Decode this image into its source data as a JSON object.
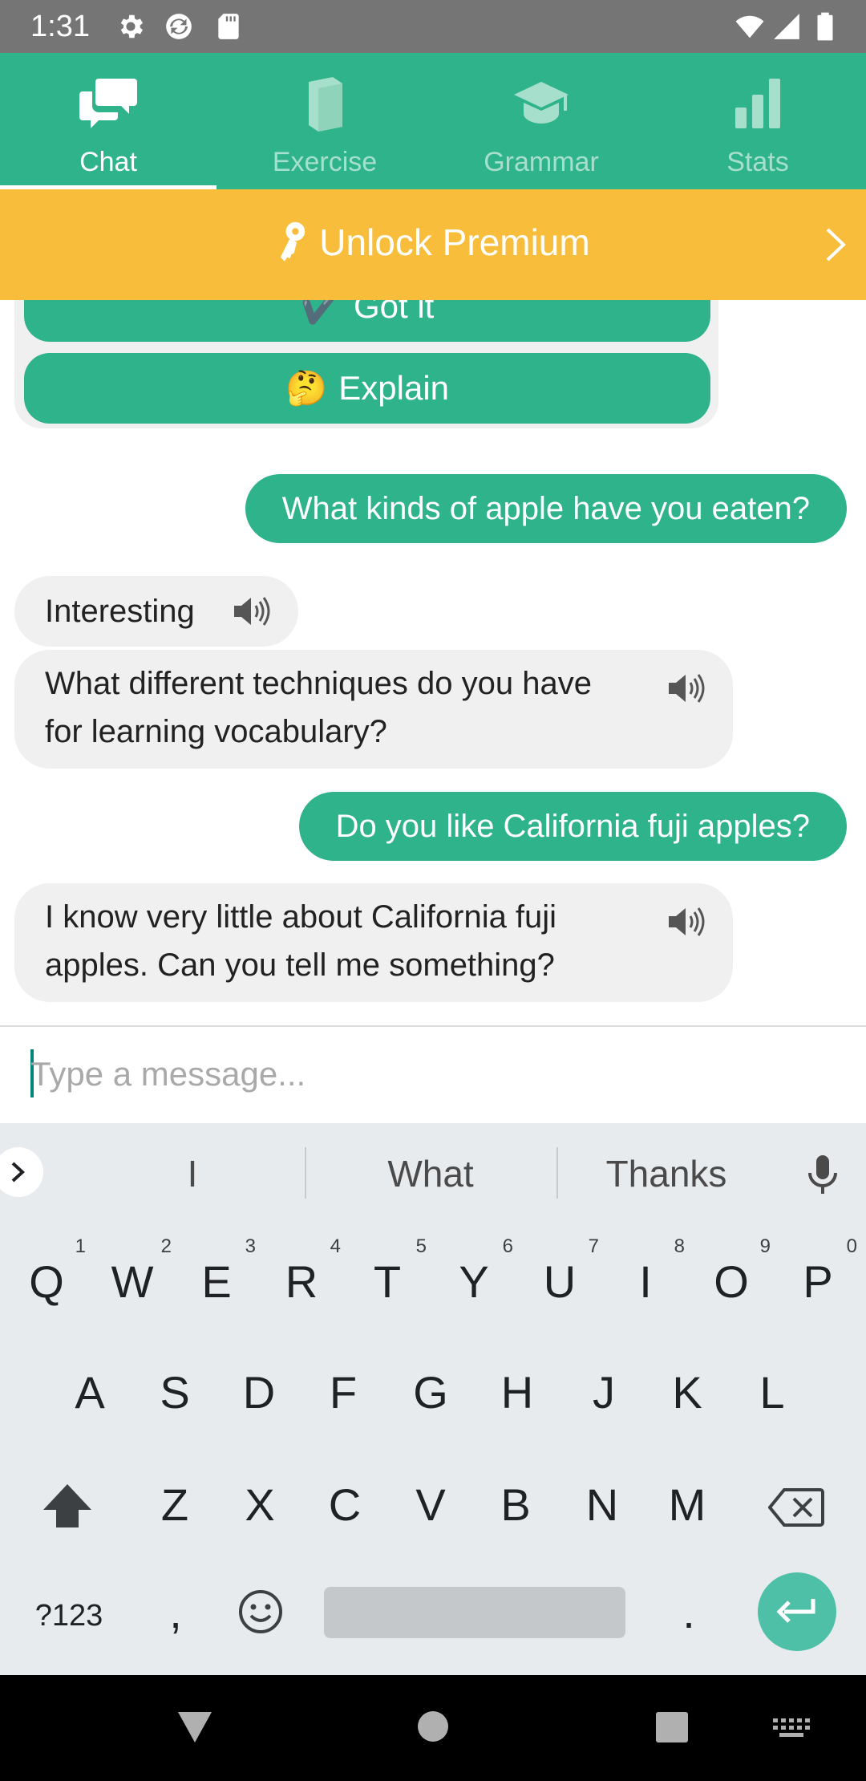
{
  "status_bar": {
    "time": "1:31",
    "left_icons": [
      "settings-icon",
      "sync-icon",
      "sd-card-icon"
    ],
    "right_icons": [
      "wifi-icon",
      "signal-icon",
      "battery-icon"
    ]
  },
  "tabs": [
    {
      "label": "Chat",
      "icon": "chat-icon",
      "active": true
    },
    {
      "label": "Exercise",
      "icon": "book-icon",
      "active": false
    },
    {
      "label": "Grammar",
      "icon": "graduation-cap-icon",
      "active": false
    },
    {
      "label": "Stats",
      "icon": "bar-chart-icon",
      "active": false
    }
  ],
  "premium": {
    "label": "Unlock Premium",
    "icon": "key-icon"
  },
  "actions": {
    "got_it": {
      "emoji": "✔️",
      "label": "Got it"
    },
    "explain": {
      "emoji": "🤔",
      "label": "Explain"
    }
  },
  "messages": [
    {
      "from": "user",
      "text": "What kinds of apple have you eaten?"
    },
    {
      "from": "bot",
      "text": "Interesting"
    },
    {
      "from": "bot",
      "line1": "What different techniques do you have",
      "line2": "for learning vocabulary?"
    },
    {
      "from": "user",
      "text": "Do you like California fuji apples?"
    },
    {
      "from": "bot",
      "line1": "I know very little about California fuji",
      "line2": "apples. Can you tell me something?"
    }
  ],
  "composer": {
    "placeholder": "Type a message...",
    "value": ""
  },
  "keyboard": {
    "suggestions": [
      "I",
      "What",
      "Thanks"
    ],
    "row1": [
      {
        "k": "Q",
        "h": "1"
      },
      {
        "k": "W",
        "h": "2"
      },
      {
        "k": "E",
        "h": "3"
      },
      {
        "k": "R",
        "h": "4"
      },
      {
        "k": "T",
        "h": "5"
      },
      {
        "k": "Y",
        "h": "6"
      },
      {
        "k": "U",
        "h": "7"
      },
      {
        "k": "I",
        "h": "8"
      },
      {
        "k": "O",
        "h": "9"
      },
      {
        "k": "P",
        "h": "0"
      }
    ],
    "row2": [
      "A",
      "S",
      "D",
      "F",
      "G",
      "H",
      "J",
      "K",
      "L"
    ],
    "row3": [
      "Z",
      "X",
      "C",
      "V",
      "B",
      "N",
      "M"
    ],
    "symbols_label": "?123",
    "comma": ",",
    "period": "."
  },
  "colors": {
    "brand": "#2fb38a",
    "premium": "#f8bd3b",
    "bot_bubble": "#f0f0f0",
    "status_bar": "#757575",
    "keyboard_bg": "#e8ebee"
  }
}
